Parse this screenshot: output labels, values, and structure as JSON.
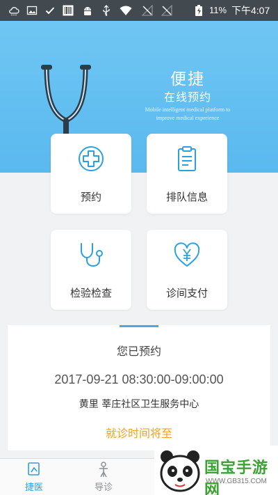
{
  "status_bar": {
    "battery_percent": "11%",
    "time": "下午4:07"
  },
  "hero": {
    "title": "便捷",
    "subtitle": "在线预约",
    "english_line1": "Mobile intelligent medical platform to",
    "english_line2": "improve medical experience"
  },
  "cards": [
    {
      "label": "预约",
      "icon": "cross-icon"
    },
    {
      "label": "排队信息",
      "icon": "clipboard-icon"
    },
    {
      "label": "检验检查",
      "icon": "stethoscope-icon"
    },
    {
      "label": "诊间支付",
      "icon": "yuan-heart-icon"
    }
  ],
  "appointment": {
    "title": "您已预约",
    "time_range": "2017-09-21 08:30:00-09:00:00",
    "place": "黄里 莘庄社区卫生服务中心",
    "status": "就诊时间将至"
  },
  "tabs": [
    {
      "label": "捷医",
      "active": true
    },
    {
      "label": "导诊",
      "active": false
    }
  ],
  "watermark": {
    "text": "国宝手游网",
    "url": "WWW.GB315.COM"
  },
  "colors": {
    "hero": "#5ab9ef",
    "accent": "#2ba0e0",
    "status_warning": "#f0a21b",
    "status_bar": "#424a4f"
  }
}
